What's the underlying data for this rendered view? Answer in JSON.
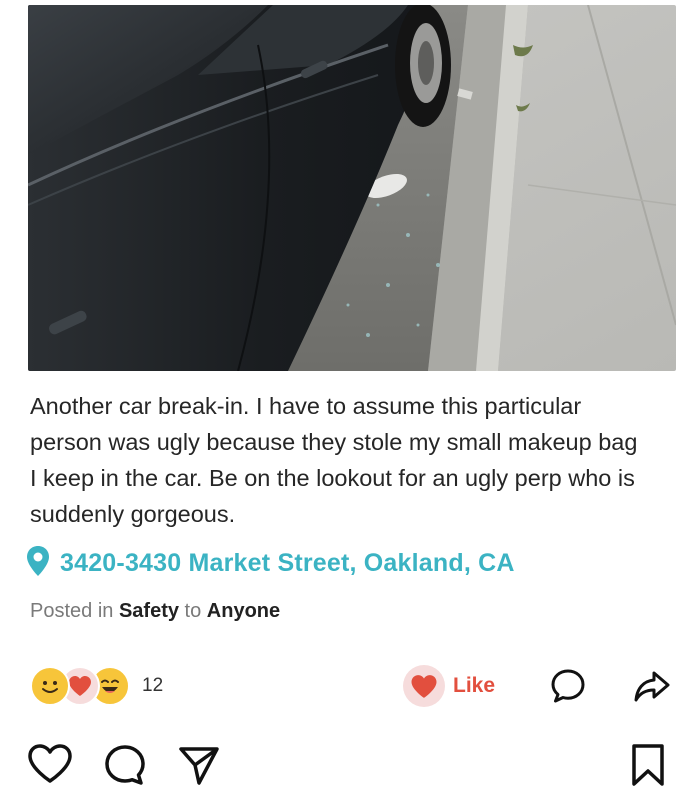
{
  "post": {
    "photo_alt": "",
    "body": "Another car break-in. I have to assume this particular person was ugly because they stole my small makeup bag I keep in the car. Be on the lookout for an ugly perp who is suddenly gorgeous.",
    "location": "3420-3430 Market Street, Oakland, CA",
    "posted_prefix": "Posted in",
    "category": "Safety",
    "posted_to": "to",
    "audience": "Anyone"
  },
  "reactions": {
    "count": "12",
    "emojis": [
      "smile-emoji-icon",
      "heart-emoji-icon",
      "laugh-emoji-icon"
    ]
  },
  "actions": {
    "like_label": "Like",
    "icons": [
      "heart-icon",
      "comment-icon",
      "share-icon"
    ]
  },
  "bottom_bar": {
    "icons": [
      "heart-outline-icon",
      "comment-outline-icon",
      "send-icon",
      "bookmark-icon"
    ]
  },
  "colors": {
    "location": "#3bb3c3",
    "like": "#e24f3e",
    "like_bg": "#f6dcdc"
  }
}
